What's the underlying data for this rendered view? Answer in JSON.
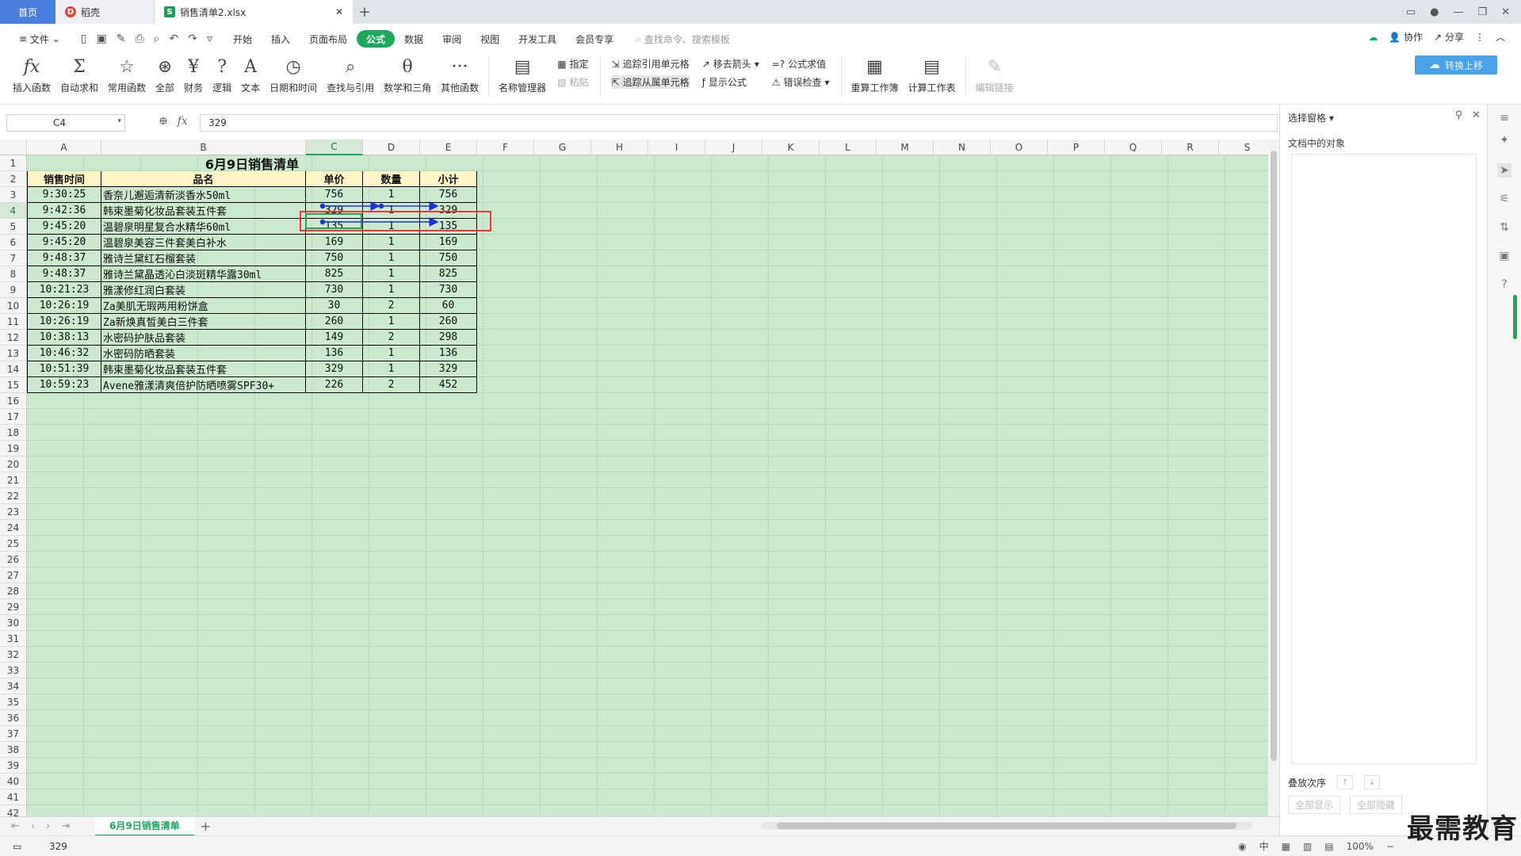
{
  "tabs": {
    "home": "首页",
    "doc": "稻壳",
    "file": "销售清单2.xlsx"
  },
  "menu": {
    "file": "文件",
    "items": [
      "开始",
      "插入",
      "页面布局",
      "公式",
      "数据",
      "审阅",
      "视图",
      "开发工具",
      "会员专享"
    ],
    "active": "公式",
    "search_placeholder": "查找命令、搜索模板",
    "collab": "协作",
    "share": "分享"
  },
  "ribbon": {
    "buttons": [
      {
        "icon": "fx",
        "label": "插入函数"
      },
      {
        "icon": "Σ",
        "label": "自动求和"
      },
      {
        "icon": "☆",
        "label": "常用函数"
      },
      {
        "icon": "⊛",
        "label": "全部"
      },
      {
        "icon": "¥",
        "label": "财务"
      },
      {
        "icon": "?",
        "label": "逻辑"
      },
      {
        "icon": "A",
        "label": "文本"
      },
      {
        "icon": "◷",
        "label": "日期和时间"
      },
      {
        "icon": "⌕",
        "label": "查找与引用"
      },
      {
        "icon": "θ",
        "label": "数学和三角"
      },
      {
        "icon": "···",
        "label": "其他函数"
      },
      {
        "icon": "▤",
        "label": "名称管理器"
      }
    ],
    "specify": "指定",
    "paste": "粘贴",
    "trace_precedents": "追踪引用单元格",
    "trace_dependents": "追踪从属单元格",
    "remove_arrows": "移去箭头",
    "show_formulas": "显示公式",
    "evaluate": "公式求值",
    "error_check": "错误检查",
    "recalc_workbook": "重算工作簿",
    "calc_sheet": "计算工作表",
    "edit_links": "编辑链接",
    "cloud_save": "转换上移"
  },
  "formula_bar": {
    "name_box": "C4",
    "fx": "fx",
    "value": "329"
  },
  "columns": [
    "A",
    "B",
    "C",
    "D",
    "E",
    "F",
    "G",
    "H",
    "I",
    "J",
    "K",
    "L",
    "M",
    "N",
    "O",
    "P",
    "Q",
    "R",
    "S"
  ],
  "selected_column": "C",
  "selected_row": 4,
  "sheet": {
    "title": "6月9日销售清单",
    "headers": [
      "销售时间",
      "品名",
      "单价",
      "数量",
      "小计"
    ],
    "rows": [
      [
        "9:30:25",
        "香奈儿邂逅清新淡香水50ml",
        "756",
        "1",
        "756"
      ],
      [
        "9:42:36",
        "韩束墨菊化妆品套装五件套",
        "329",
        "1",
        "329"
      ],
      [
        "9:45:20",
        "温碧泉明星复合水精华60ml",
        "135",
        "1",
        "135"
      ],
      [
        "9:45:20",
        "温碧泉美容三件套美白补水",
        "169",
        "1",
        "169"
      ],
      [
        "9:48:37",
        "雅诗兰黛红石榴套装",
        "750",
        "1",
        "750"
      ],
      [
        "9:48:37",
        "雅诗兰黛晶透沁白淡斑精华露30ml",
        "825",
        "1",
        "825"
      ],
      [
        "10:21:23",
        "雅漾修红润白套装",
        "730",
        "1",
        "730"
      ],
      [
        "10:26:19",
        "Za美肌无瑕两用粉饼盒",
        "30",
        "2",
        "60"
      ],
      [
        "10:26:19",
        "Za新焕真皙美白三件套",
        "260",
        "1",
        "260"
      ],
      [
        "10:38:13",
        "水密码护肤品套装",
        "149",
        "2",
        "298"
      ],
      [
        "10:46:32",
        "水密码防晒套装",
        "136",
        "1",
        "136"
      ],
      [
        "10:51:39",
        "韩束墨菊化妆品套装五件套",
        "329",
        "1",
        "329"
      ],
      [
        "10:59:23",
        "Avene雅漾清爽倍护防晒喷雾SPF30+",
        "226",
        "2",
        "452"
      ]
    ]
  },
  "sheet_tab": "6月9日销售清单",
  "status": {
    "value": "329",
    "zoom": "100%"
  },
  "pane": {
    "title": "选择窗格",
    "objects_label": "文档中的对象",
    "order_label": "叠放次序",
    "show_all": "全部显示",
    "hide_all": "全部隐藏"
  },
  "brand": "最需教育",
  "colors": {
    "accent": "#1fa75f",
    "sheet_bg": "#cce8cf",
    "header_fill": "#fdf5c8",
    "trace_arrow": "#1a33d6",
    "highlight_box": "#e83a3a"
  }
}
